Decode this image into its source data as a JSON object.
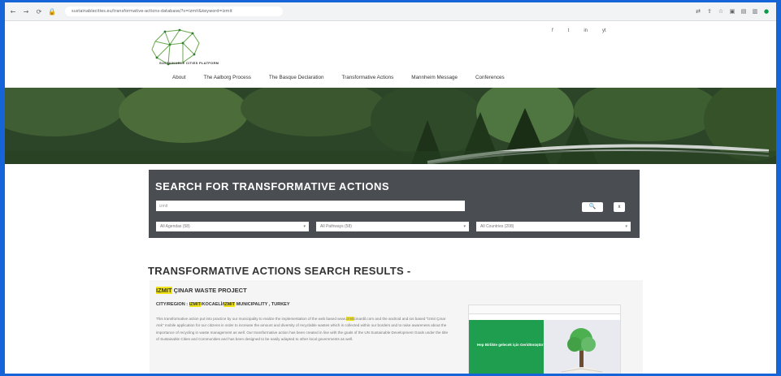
{
  "browser": {
    "url": "sustainablecities.eu/transformative-actions-database/?s=izmit&keyword=izmit",
    "nav_icons": [
      "back-icon",
      "forward-icon",
      "reload-icon",
      "lock-icon"
    ],
    "extension_icons": [
      "translate-icon",
      "share-icon",
      "star-icon",
      "extension-icon",
      "tab-icon",
      "sidebar-icon",
      "profile-icon"
    ]
  },
  "site": {
    "logo_text": "SUSTAINABLE CITIES PLATFORM",
    "social": [
      "f",
      "t",
      "in",
      "yt"
    ],
    "menu": [
      "About",
      "The Aalborg Process",
      "The Basque Declaration",
      "Transformative Actions",
      "Mannheim Message",
      "Conferences"
    ]
  },
  "search": {
    "title": "SEARCH FOR TRANSFORMATIVE ACTIONS",
    "input_value": "izmit",
    "search_icon": "search-icon",
    "reset_label": "x",
    "filters": [
      "All Agendas (58)",
      "All Pathways (58)",
      "All Countries (208)"
    ]
  },
  "results": {
    "heading": "TRANSFORMATIVE ACTIONS SEARCH RESULTS -",
    "item": {
      "title_highlight": "IZMIT",
      "title_rest": " ÇINAR WASTE PROJECT",
      "city_prefix": "CITY/REGION : ",
      "city_highlight1": "IZMIT",
      "city_mid": "/KOCAELİ/",
      "city_highlight2": "IZMIT",
      "city_rest": " MUNICIPALITY , TURKEY",
      "description_start": "This transformative action put into practice by our municipality to realize the implementation of the web based www.",
      "description_highlight": "izmit",
      "description_rest": "cinardil.com and the android and ios based \"İzmit Çınar Atık\" mobile application for our citizens in order to increase the amount and diversity of recyclable wastes which is collected within our borders and to raise awareness about the importance of recycling in waste management as well. Our transformative action has been created in line with the goals of the UN Sustainable Development Goals under the title of Sustainable Cities and Communities and has been designed to be easily adapted to other local governments as well.",
      "thumb_text": "Hep Birlikte gelecek için Geridönüştür"
    }
  }
}
